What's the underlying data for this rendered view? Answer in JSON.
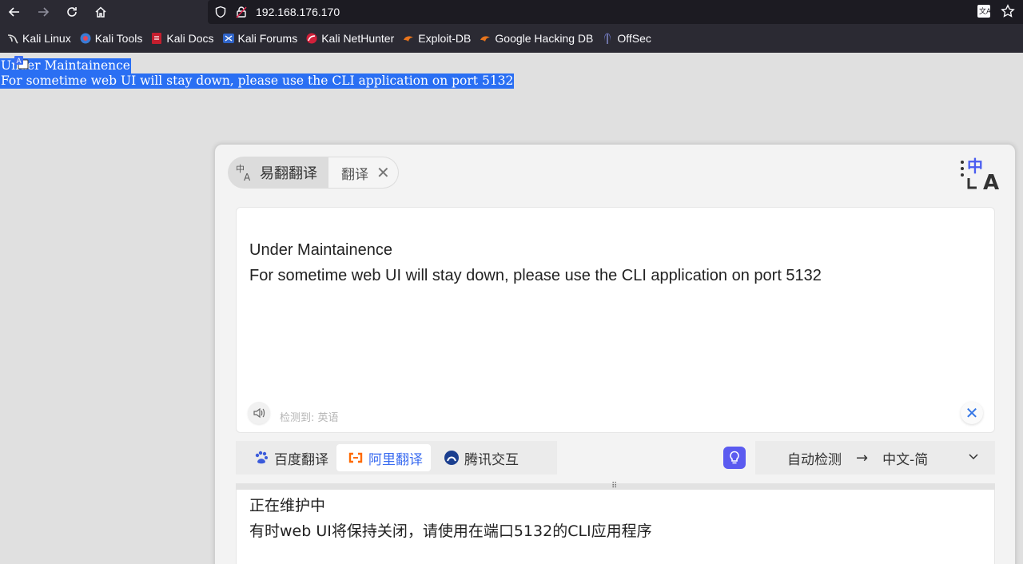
{
  "browser": {
    "url": "192.168.176.170",
    "bookmarks": [
      {
        "label": "Kali Linux",
        "icon": "kali-dragon-icon"
      },
      {
        "label": "Kali Tools",
        "icon": "kali-tools-icon"
      },
      {
        "label": "Kali Docs",
        "icon": "kali-docs-icon"
      },
      {
        "label": "Kali Forums",
        "icon": "kali-forums-icon"
      },
      {
        "label": "Kali NetHunter",
        "icon": "kali-nethunter-icon"
      },
      {
        "label": "Exploit-DB",
        "icon": "exploit-db-icon"
      },
      {
        "label": "Google Hacking DB",
        "icon": "ghdb-icon"
      },
      {
        "label": "OffSec",
        "icon": "offsec-icon"
      }
    ]
  },
  "page": {
    "line1": "Under Maintainence",
    "line2": "For sometime web UI will stay down, please use the CLI application on port 5132"
  },
  "translator": {
    "tab_main": "易翻翻译",
    "tab_second": "翻译",
    "source_line1": "Under Maintainence",
    "source_line2": "For sometime web UI will stay down, please use the CLI application on port 5132",
    "detected": "检测到: 英语",
    "engines": [
      {
        "label": "百度翻译",
        "active": false
      },
      {
        "label": "阿里翻译",
        "active": true
      },
      {
        "label": "腾讯交互",
        "active": false
      }
    ],
    "source_lang": "自动检测",
    "target_lang": "中文-简",
    "output_line1": "正在维护中",
    "output_line2": "有时web UI将保持关闭，请使用在端口5132的CLI应用程序",
    "accent_color": "#3b6cf0"
  }
}
